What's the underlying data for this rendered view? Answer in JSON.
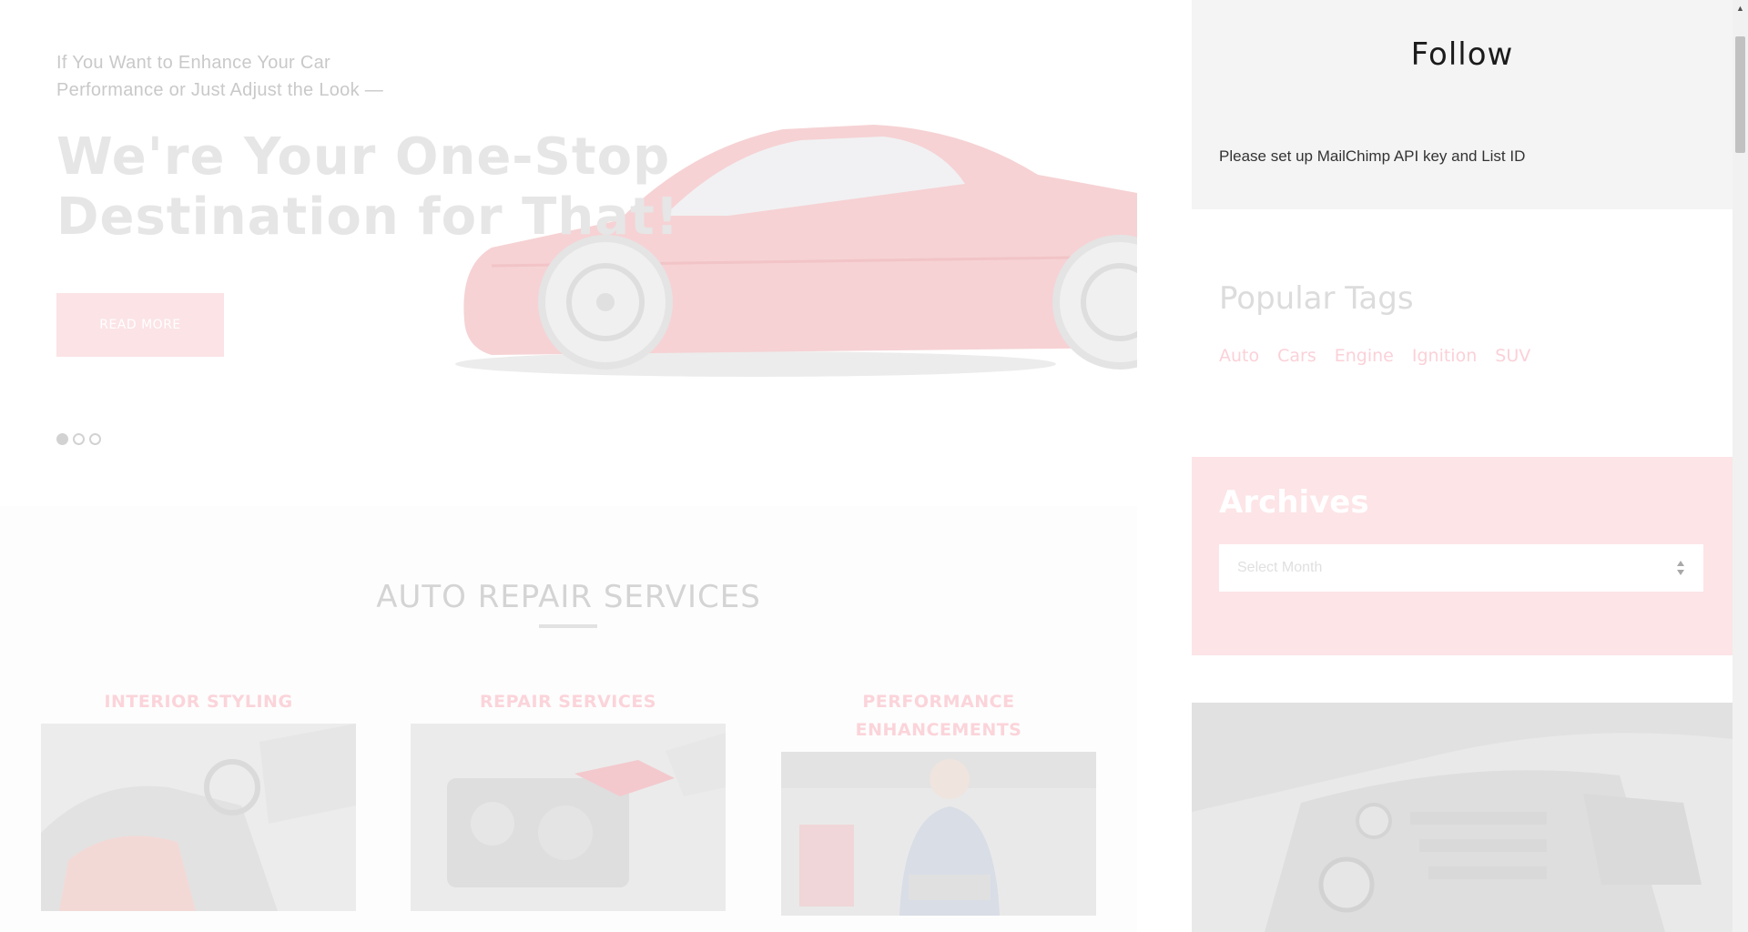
{
  "hero": {
    "kicker": "If You Want to Enhance Your Car Performance or Just Adjust the Look —",
    "heading": "We're Your One-Stop Destination for That!",
    "button_label": "READ MORE",
    "slides_total": 3,
    "slide_active": 1
  },
  "services": {
    "title": "AUTO REPAIR SERVICES",
    "items": [
      {
        "title": "INTERIOR STYLING",
        "image": "car-interior-photo"
      },
      {
        "title": "REPAIR SERVICES",
        "image": "engine-repair-photo"
      },
      {
        "title": "PERFORMANCE ENHANCEMENTS",
        "image": "mechanic-photo"
      }
    ]
  },
  "sidebar": {
    "follow": {
      "title": "Follow",
      "message": "Please set up MailChimp API key and List ID"
    },
    "tags": {
      "title": "Popular Tags",
      "items": [
        "Auto",
        "Cars",
        "Engine",
        "Ignition",
        "SUV"
      ]
    },
    "archives": {
      "title": "Archives",
      "select_placeholder": "Select Month"
    },
    "image": "car-dashboard-photo"
  },
  "colors": {
    "accent_faded": "#fde4e7",
    "accent_text_faded": "#fbd1d8"
  }
}
